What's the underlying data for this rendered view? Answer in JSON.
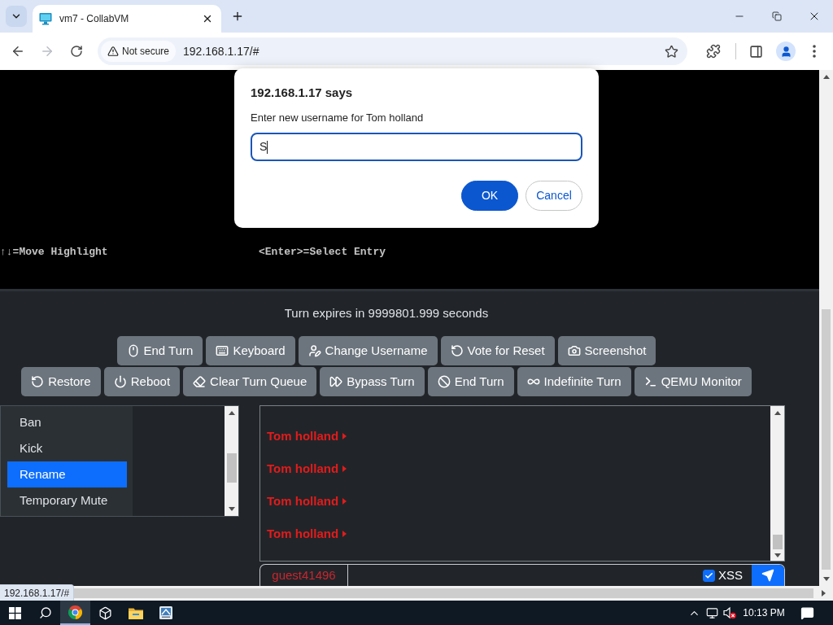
{
  "browser": {
    "tabs": [
      {
        "title": "vm7 - CollabVM",
        "selected": true
      }
    ],
    "navigation": {
      "forward_disabled": true
    },
    "address_bar": {
      "security_label": "Not secure",
      "url": "192.168.1.17/#"
    }
  },
  "vm_screen": {
    "lines": [
      "↑↓=Move Highlight",
      "<Enter>=Select Entry"
    ]
  },
  "dialog": {
    "title": "192.168.1.17 says",
    "message": "Enter new username for Tom holland",
    "input_value": "S",
    "buttons": [
      {
        "label": "OK",
        "kind": "primary"
      },
      {
        "label": "Cancel",
        "kind": "secondary"
      }
    ]
  },
  "turn_status": "Turn expires in 9999801.999 seconds",
  "button_rows": [
    {
      "buttons": [
        {
          "label": "End Turn"
        },
        {
          "label": "Keyboard"
        },
        {
          "label": "Change Username"
        },
        {
          "label": "Vote for Reset"
        },
        {
          "label": "Screenshot"
        }
      ]
    },
    {
      "buttons": [
        {
          "label": "Restore"
        },
        {
          "label": "Reboot"
        },
        {
          "label": "Clear Turn Queue"
        },
        {
          "label": "Bypass Turn"
        },
        {
          "label": "End Turn"
        },
        {
          "label": "Indefinite Turn"
        },
        {
          "label": "QEMU Monitor"
        }
      ]
    }
  ],
  "user_list": {
    "context_menu": [
      {
        "label": "Ban",
        "selected": false
      },
      {
        "label": "Kick",
        "selected": false
      },
      {
        "label": "Rename",
        "selected": true
      },
      {
        "label": "Temporary Mute",
        "selected": false
      }
    ]
  },
  "chat": {
    "messages": [
      {
        "username": "Tom holland"
      },
      {
        "username": "Tom holland"
      },
      {
        "username": "Tom holland"
      },
      {
        "username": "Tom holland"
      }
    ],
    "input": {
      "username": "guest41496"
    },
    "xss": {
      "label": "XSS",
      "checked": true
    }
  },
  "status_bubble": "192.168.1.17/#",
  "taskbar": {
    "apps": [
      {
        "selected": true
      },
      {
        "selected": false
      },
      {
        "selected": false
      },
      {
        "selected": false
      }
    ],
    "clock": "10:13 PM"
  }
}
